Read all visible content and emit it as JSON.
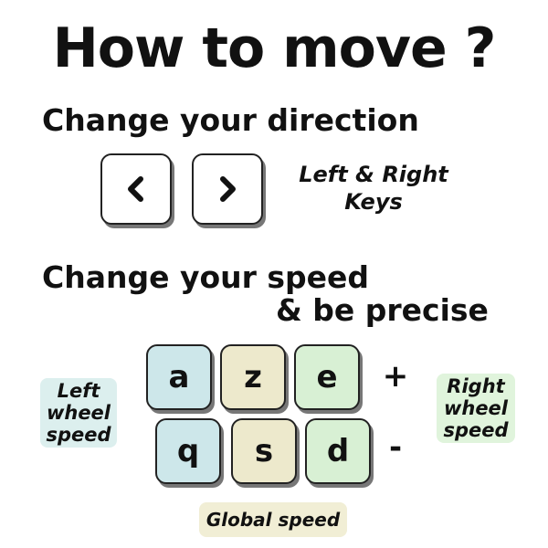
{
  "title": "How to move ?",
  "direction": {
    "heading": "Change your direction",
    "keys_caption_line1": "Left & Right",
    "keys_caption_line2": "Keys"
  },
  "speed": {
    "heading_line1": "Change your speed",
    "heading_line2": "& be precise",
    "top_row": [
      "a",
      "z",
      "e"
    ],
    "bottom_row": [
      "q",
      "s",
      "d"
    ],
    "plus": "+",
    "minus": "-",
    "left_label": [
      "Left",
      "wheel",
      "speed"
    ],
    "right_label": [
      "Right",
      "wheel",
      "speed"
    ],
    "global_label": "Global speed"
  },
  "colors": {
    "left_keys": "#cde7ea",
    "middle_keys": "#ede9cc",
    "right_keys": "#d8f0d4"
  }
}
